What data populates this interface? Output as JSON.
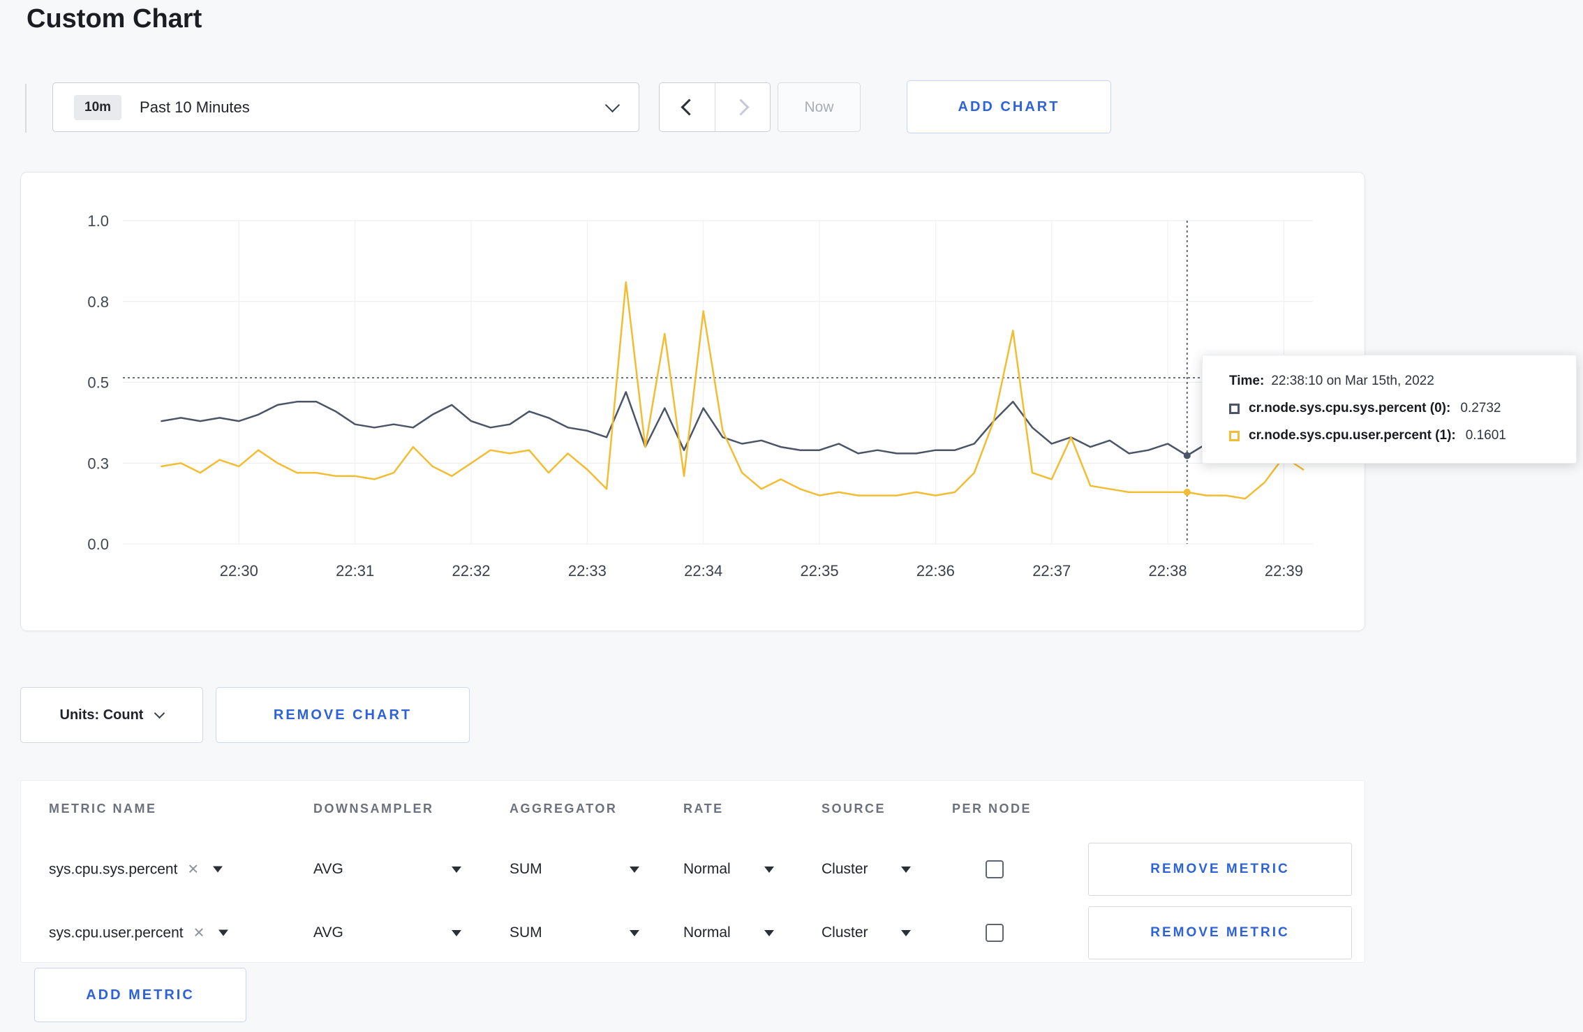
{
  "page": {
    "title": "Custom Chart"
  },
  "colors": {
    "accent_blue": "#2d62d9",
    "series_sys": "#4c5567",
    "series_user": "#f2bd33"
  },
  "toolbar": {
    "time_badge": "10m",
    "time_range_label": "Past 10 Minutes",
    "now_label": "Now",
    "add_chart_label": "ADD CHART"
  },
  "chart_controls": {
    "units_label": "Units: Count",
    "remove_chart_label": "REMOVE CHART",
    "add_metric_label": "ADD METRIC"
  },
  "tooltip": {
    "time_label": "Time:",
    "time_value": "22:38:10 on Mar 15th, 2022",
    "series": [
      {
        "name": "cr.node.sys.cpu.sys.percent (0):",
        "value": "0.2732",
        "color": "#4c5567"
      },
      {
        "name": "cr.node.sys.cpu.user.percent (1):",
        "value": "0.1601",
        "color": "#f2bd33"
      }
    ]
  },
  "table": {
    "headers": [
      "METRIC NAME",
      "DOWNSAMPLER",
      "AGGREGATOR",
      "RATE",
      "SOURCE",
      "PER NODE"
    ],
    "remove_icon": "✕",
    "rows": [
      {
        "name": "sys.cpu.sys.percent",
        "downsampler": "AVG",
        "aggregator": "SUM",
        "rate": "Normal",
        "source": "Cluster",
        "per_node_checked": false,
        "remove_label": "REMOVE METRIC"
      },
      {
        "name": "sys.cpu.user.percent",
        "downsampler": "AVG",
        "aggregator": "SUM",
        "rate": "Normal",
        "source": "Cluster",
        "per_node_checked": false,
        "remove_label": "REMOVE METRIC"
      }
    ]
  },
  "chart_data": {
    "type": "line",
    "title": "",
    "xlabel": "",
    "ylabel": "",
    "grid": true,
    "legend_position": "tooltip",
    "x_axis": {
      "base_time": "22:29:00",
      "start_seconds": 0,
      "end_seconds": 615,
      "ticks": [
        {
          "label": "22:30",
          "t": 60
        },
        {
          "label": "22:31",
          "t": 120
        },
        {
          "label": "22:32",
          "t": 180
        },
        {
          "label": "22:33",
          "t": 240
        },
        {
          "label": "22:34",
          "t": 300
        },
        {
          "label": "22:35",
          "t": 360
        },
        {
          "label": "22:36",
          "t": 420
        },
        {
          "label": "22:37",
          "t": 480
        },
        {
          "label": "22:38",
          "t": 540
        },
        {
          "label": "22:39",
          "t": 600
        }
      ]
    },
    "y_axis": {
      "min": 0,
      "max": 1,
      "ticks": [
        {
          "label": "0.0",
          "v": 0
        },
        {
          "label": "0.3",
          "v": 0.25
        },
        {
          "label": "0.5",
          "v": 0.5
        },
        {
          "label": "0.8",
          "v": 0.75
        },
        {
          "label": "1.0",
          "v": 1
        }
      ]
    },
    "series": [
      {
        "name": "cr.node.sys.cpu.sys.percent",
        "color": "#4c5567",
        "t0": 20,
        "dt": 10,
        "values": [
          0.38,
          0.39,
          0.38,
          0.39,
          0.38,
          0.4,
          0.43,
          0.44,
          0.44,
          0.41,
          0.37,
          0.36,
          0.37,
          0.36,
          0.4,
          0.43,
          0.38,
          0.36,
          0.37,
          0.41,
          0.39,
          0.36,
          0.35,
          0.33,
          0.47,
          0.3,
          0.42,
          0.29,
          0.42,
          0.33,
          0.31,
          0.32,
          0.3,
          0.29,
          0.29,
          0.31,
          0.28,
          0.29,
          0.28,
          0.28,
          0.29,
          0.29,
          0.31,
          0.38,
          0.44,
          0.36,
          0.31,
          0.33,
          0.3,
          0.32,
          0.28,
          0.29,
          0.31,
          0.2732,
          0.31,
          0.29,
          0.31,
          0.3,
          0.3,
          0.31
        ]
      },
      {
        "name": "cr.node.sys.cpu.user.percent",
        "color": "#f2bd33",
        "t0": 20,
        "dt": 10,
        "values": [
          0.24,
          0.25,
          0.22,
          0.26,
          0.24,
          0.29,
          0.25,
          0.22,
          0.22,
          0.21,
          0.21,
          0.2,
          0.22,
          0.3,
          0.24,
          0.21,
          0.25,
          0.29,
          0.28,
          0.29,
          0.22,
          0.28,
          0.23,
          0.17,
          0.81,
          0.3,
          0.65,
          0.21,
          0.72,
          0.35,
          0.22,
          0.17,
          0.2,
          0.17,
          0.15,
          0.16,
          0.15,
          0.15,
          0.15,
          0.16,
          0.15,
          0.16,
          0.22,
          0.38,
          0.66,
          0.22,
          0.2,
          0.33,
          0.18,
          0.17,
          0.16,
          0.16,
          0.16,
          0.1601,
          0.15,
          0.15,
          0.14,
          0.19,
          0.27,
          0.23
        ]
      }
    ],
    "crosshair": {
      "t_seconds": 550,
      "y_value": 0.514
    },
    "markers": [
      {
        "series": 0,
        "t_seconds": 550,
        "value": 0.2732
      },
      {
        "series": 1,
        "t_seconds": 550,
        "value": 0.1601
      }
    ]
  }
}
